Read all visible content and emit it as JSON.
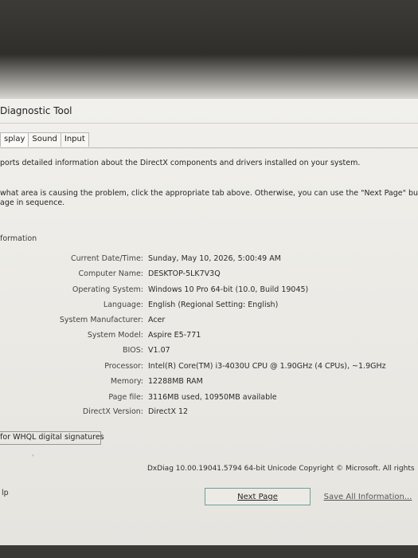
{
  "window": {
    "title": "Diagnostic Tool"
  },
  "tabs": [
    "splay",
    "Sound",
    "Input"
  ],
  "description": "ports detailed information about the DirectX components and drivers installed on your system.",
  "hint_lines": [
    "what area is causing the problem, click the appropriate tab above.  Otherwise, you can use the \"Next Page\" button",
    "age in sequence."
  ],
  "section_label": "formation",
  "system_info": [
    {
      "label": "Current Date/Time:",
      "value": "Sunday, May 10, 2026, 5:00:49 AM"
    },
    {
      "label": "Computer Name:",
      "value": "DESKTOP-5LK7V3Q"
    },
    {
      "label": "Operating System:",
      "value": "Windows 10 Pro 64-bit (10.0, Build 19045)"
    },
    {
      "label": "Language:",
      "value": "English (Regional Setting: English)"
    },
    {
      "label": "System Manufacturer:",
      "value": "Acer"
    },
    {
      "label": "System Model:",
      "value": "Aspire E5-771"
    },
    {
      "label": "BIOS:",
      "value": "V1.07"
    },
    {
      "label": "Processor:",
      "value": "Intel(R) Core(TM) i3-4030U CPU @ 1.90GHz (4 CPUs), ~1.9GHz"
    },
    {
      "label": "Memory:",
      "value": "12288MB RAM"
    },
    {
      "label": "Page file:",
      "value": "3116MB used, 10950MB available"
    },
    {
      "label": "DirectX Version:",
      "value": "DirectX 12"
    }
  ],
  "whql_checkbox_label": "for WHQL digital signatures",
  "dxdiag_version": "DxDiag 10.00.19041.5794 64-bit Unicode  Copyright © Microsoft. All rights",
  "buttons": {
    "help": "lp",
    "next_page": "Next Page",
    "save_all": "Save All Information..."
  }
}
